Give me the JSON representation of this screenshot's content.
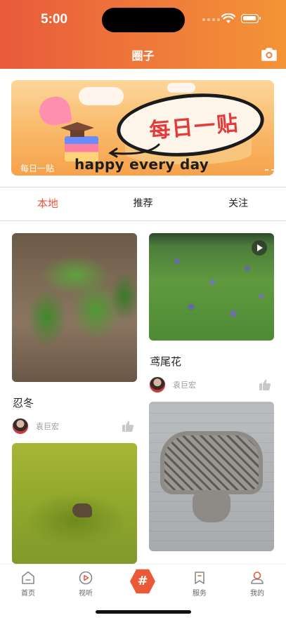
{
  "status_bar": {
    "time": "5:00"
  },
  "header": {
    "title": "圈子",
    "camera_icon": "camera-icon"
  },
  "banner": {
    "bubble_text": "每日一贴",
    "tag_label": "每日一贴",
    "slogan": "happy every day"
  },
  "tabs": [
    {
      "label": "本地",
      "active": true
    },
    {
      "label": "推荐",
      "active": false
    },
    {
      "label": "关注",
      "active": false
    }
  ],
  "posts": [
    {
      "title": "忍冬",
      "author": "袁巨宏",
      "has_video": false
    },
    {
      "title": "鸢尾花",
      "author": "袁巨宏",
      "has_video": true
    }
  ],
  "bottom_nav": [
    {
      "label": "首页",
      "icon": "home-icon"
    },
    {
      "label": "视听",
      "icon": "play-circle-icon"
    },
    {
      "label": "#",
      "icon": "hashtag-icon"
    },
    {
      "label": "服务",
      "icon": "bookmark-icon"
    },
    {
      "label": "我的",
      "icon": "profile-icon"
    }
  ],
  "colors": {
    "accent": "#e8573c",
    "header_start": "#e85a3b",
    "header_end": "#f39436"
  }
}
